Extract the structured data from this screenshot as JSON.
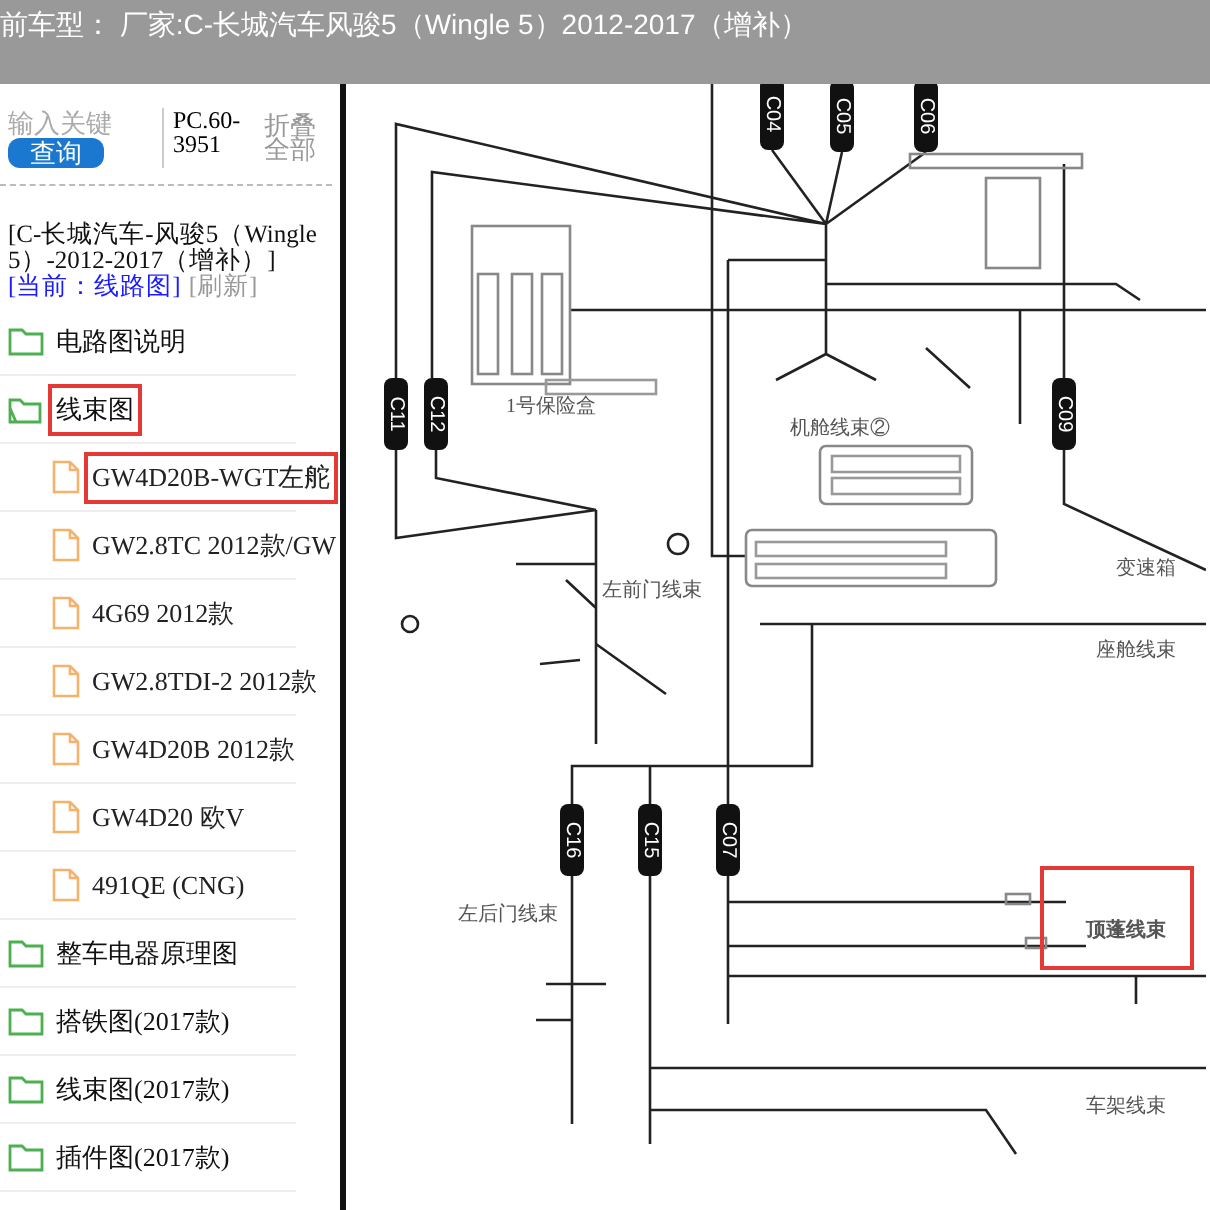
{
  "header": {
    "title": "前车型： 厂家:C-长城汽车风骏5（Wingle 5）2012-2017（增补）"
  },
  "sidebar": {
    "search": {
      "placeholder": "输入关键",
      "button": "查询"
    },
    "code": "PC.60-3951",
    "collapse": "折叠全部",
    "vehicle": "[C-长城汽车-风骏5（Wingle 5）-2012-2017（增补）]",
    "current": "[当前：线路图]",
    "refresh": "[刷新]",
    "tree": [
      {
        "label": "电路图说明",
        "expanded": false,
        "highlighted": false
      },
      {
        "label": "线束图",
        "expanded": true,
        "highlighted": true,
        "children": [
          {
            "label": "GW4D20B-WGT左舵",
            "highlighted": true
          },
          {
            "label": "GW2.8TC 2012款/GW",
            "highlighted": false
          },
          {
            "label": "4G69 2012款",
            "highlighted": false
          },
          {
            "label": "GW2.8TDI-2 2012款",
            "highlighted": false
          },
          {
            "label": "GW4D20B 2012款",
            "highlighted": false
          },
          {
            "label": "GW4D20 欧V",
            "highlighted": false
          },
          {
            "label": "491QE (CNG)",
            "highlighted": false
          }
        ]
      },
      {
        "label": "整车电器原理图",
        "expanded": false,
        "highlighted": false
      },
      {
        "label": "搭铁图(2017款)",
        "expanded": false,
        "highlighted": false
      },
      {
        "label": "线束图(2017款)",
        "expanded": false,
        "highlighted": false
      },
      {
        "label": "插件图(2017款)",
        "expanded": false,
        "highlighted": false
      }
    ]
  },
  "diagram": {
    "connectors": [
      "C04",
      "C05",
      "C06",
      "C11",
      "C12",
      "C09",
      "C16",
      "C15",
      "C07"
    ],
    "labels": [
      {
        "text": "1号保险盒",
        "highlighted": false
      },
      {
        "text": "机舱线束②",
        "highlighted": false
      },
      {
        "text": "左前门线束",
        "highlighted": false
      },
      {
        "text": "变速箱",
        "highlighted": false
      },
      {
        "text": "座舱线束",
        "highlighted": false
      },
      {
        "text": "左后门线束",
        "highlighted": false
      },
      {
        "text": "顶蓬线束",
        "highlighted": true
      },
      {
        "text": "车架线束",
        "highlighted": false
      }
    ]
  }
}
